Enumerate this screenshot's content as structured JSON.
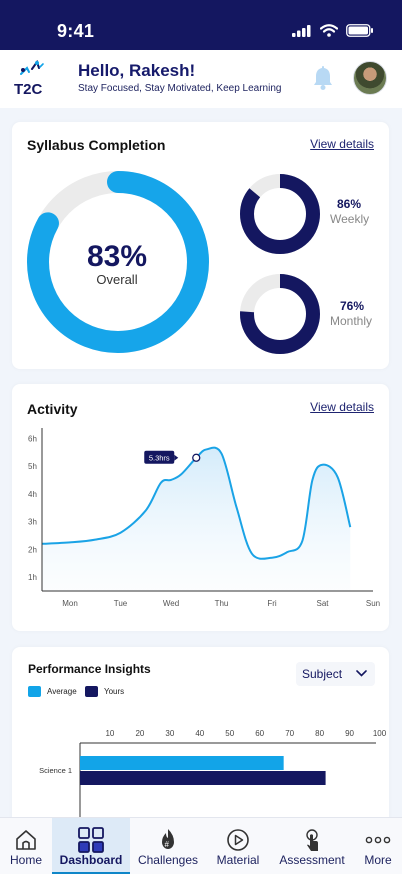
{
  "status": {
    "time": "9:41"
  },
  "header": {
    "logo_text": "T2C",
    "greeting": "Hello, Rakesh!",
    "tagline": "Stay Focused, Stay Motivated, Keep Learning"
  },
  "syllabus": {
    "title": "Syllabus Completion",
    "view_details": "View details",
    "overall": {
      "percent_label": "83%",
      "value": 83,
      "label": "Overall"
    },
    "weekly": {
      "percent_label": "86%",
      "value": 86,
      "label": "Weekly"
    },
    "monthly": {
      "percent_label": "76%",
      "value": 76,
      "label": "Monthly"
    }
  },
  "activity": {
    "title": "Activity",
    "view_details": "View details",
    "tooltip": "5.3hrs"
  },
  "performance": {
    "title": "Performance Insights",
    "subject_select": "Subject",
    "legend": [
      {
        "name": "Average",
        "color": "#12a4e8"
      },
      {
        "name": "Yours",
        "color": "#141760"
      }
    ]
  },
  "chart_data": [
    {
      "type": "area",
      "title": "Activity",
      "categories": [
        "Mon",
        "Tue",
        "Wed",
        "Thu",
        "Fri",
        "Sat",
        "Sun"
      ],
      "y_tick_labels": [
        "1h",
        "2h",
        "3h",
        "4h",
        "5h",
        "6h"
      ],
      "ylim": [
        0.5,
        6.3
      ],
      "x": [
        -0.55,
        0.0,
        0.5,
        1.0,
        1.5,
        1.8,
        2.0,
        2.2,
        2.5,
        2.7,
        3.0,
        3.3,
        3.6,
        4.0,
        4.3,
        4.6,
        4.8,
        5.0,
        5.3,
        5.55
      ],
      "values": [
        2.2,
        2.25,
        2.35,
        2.6,
        3.4,
        4.4,
        4.5,
        4.7,
        5.3,
        5.6,
        5.45,
        3.5,
        1.85,
        1.7,
        1.9,
        2.3,
        4.5,
        5.05,
        4.6,
        2.8
      ],
      "annotation": {
        "x": 2.5,
        "y": 5.3,
        "label": "5.3hrs"
      },
      "grid": false,
      "colors": {
        "line": "#1aa3e6"
      }
    },
    {
      "type": "bar",
      "orientation": "horizontal",
      "categories": [
        "Science 1"
      ],
      "x_tick_labels": [
        "10",
        "20",
        "30",
        "40",
        "50",
        "60",
        "70",
        "80",
        "90",
        "100"
      ],
      "xlim": [
        0,
        100
      ],
      "series": [
        {
          "name": "Average",
          "values": [
            68
          ],
          "color": "#12a4e8"
        },
        {
          "name": "Yours",
          "values": [
            82
          ],
          "color": "#141760"
        }
      ]
    }
  ],
  "nav": {
    "items": [
      {
        "label": "Home",
        "icon": "home-icon"
      },
      {
        "label": "Dashboard",
        "icon": "dashboard-icon",
        "active": true
      },
      {
        "label": "Challenges",
        "icon": "challenges-icon"
      },
      {
        "label": "Material",
        "icon": "material-icon"
      },
      {
        "label": "Assessment",
        "icon": "assessment-icon"
      },
      {
        "label": "More",
        "icon": "more-icon"
      }
    ]
  }
}
